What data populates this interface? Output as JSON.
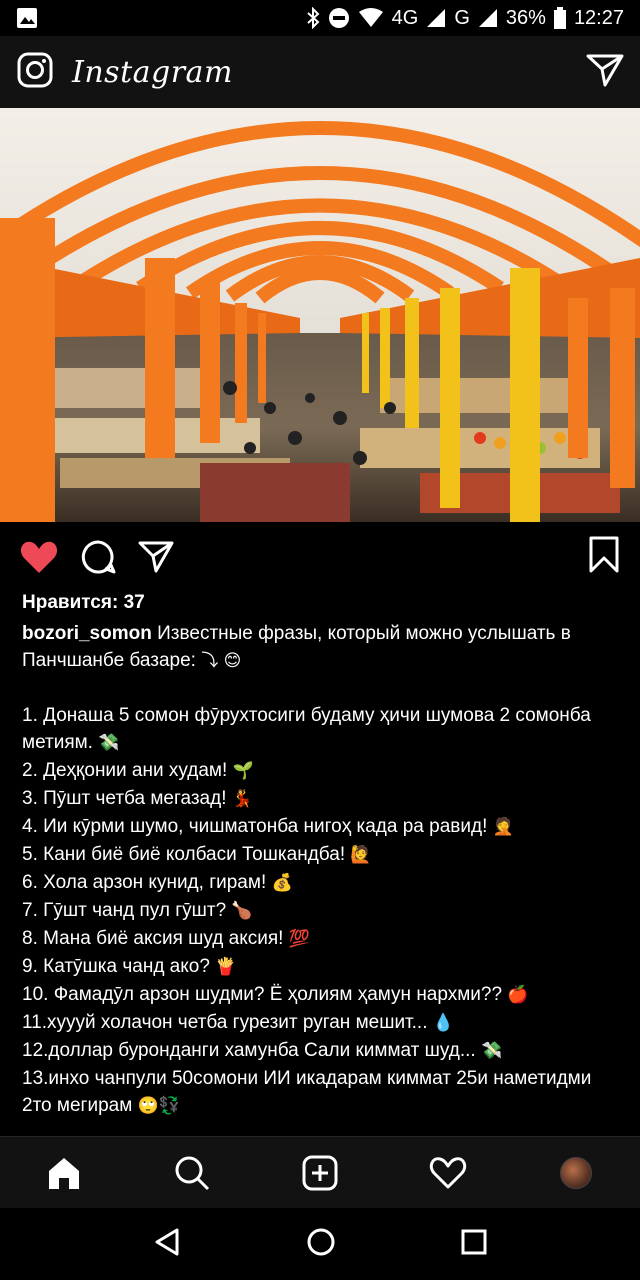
{
  "status_bar": {
    "network_4g": "4G",
    "network_g": "G",
    "battery": "36%",
    "time": "12:27",
    "icons": [
      "image-icon",
      "bluetooth-icon",
      "do-not-disturb-icon",
      "wifi-icon",
      "signal-icon",
      "battery-icon"
    ]
  },
  "app_bar": {
    "title": "Instagram",
    "icons": [
      "camera-icon",
      "direct-message-icon"
    ]
  },
  "post": {
    "image_colors": {
      "arches": "#f47a1f",
      "ceiling": "#f3efe8",
      "pillars_yellow": "#f2c21a"
    },
    "liked": true,
    "likes_label": "Нравится: 37",
    "username": "bozori_somon",
    "caption_intro": "Известные фразы, который можно услышать в Панчшанбе базаре:",
    "caption_intro_emoji": "⤵ 😊",
    "phrases": [
      {
        "text": "1. Донаша 5 сомон фӯрухтосиги будаму ҳичи шумова 2 сомонба метиям.",
        "emoji": "💸"
      },
      {
        "text": "2. Деҳқонии ани худам!",
        "emoji": "🌱"
      },
      {
        "text": "3. Пӯшт четба мегазад!",
        "emoji": "💃"
      },
      {
        "text": "4. Ии кӯрми шумо, чишматонба нигоҳ када ра равид!",
        "emoji": "🤦"
      },
      {
        "text": "5. Кани биё биё колбаси Тошкандба!",
        "emoji": "🙋"
      },
      {
        "text": "6. Хола арзон кунид, гирам!",
        "emoji": "💰"
      },
      {
        "text": "7. Гӯшт чанд пул гӯшт?",
        "emoji": "🍗"
      },
      {
        "text": "8. Мана биё аксия шуд аксия!",
        "emoji": "💯"
      },
      {
        "text": "9. Катӯшка чанд ако?",
        "emoji": "🍟"
      },
      {
        "text": "10. Фамадӯл арзон шудми? Ё ҳолиям ҳамун нархми??",
        "emoji": "🍎"
      },
      {
        "text": "11.хуууй холачон четба гурезит руган мешит...",
        "emoji": "💧"
      },
      {
        "text": "12.доллар буронданги хамунба Сали киммат шуд...",
        "emoji": "💸"
      },
      {
        "text": "13.инхо чанпули 50сомони ИИ икадарам киммат 25и наметидми 2то мегирам",
        "emoji": "🙄💱"
      }
    ],
    "action_icons": [
      "heart-icon",
      "comment-icon",
      "share-icon",
      "bookmark-icon"
    ]
  },
  "bottom_nav": {
    "items": [
      "home-icon",
      "search-icon",
      "add-post-icon",
      "activity-heart-icon",
      "profile-avatar"
    ]
  },
  "system_nav": {
    "items": [
      "back-icon",
      "home-circle-icon",
      "recents-icon"
    ]
  }
}
